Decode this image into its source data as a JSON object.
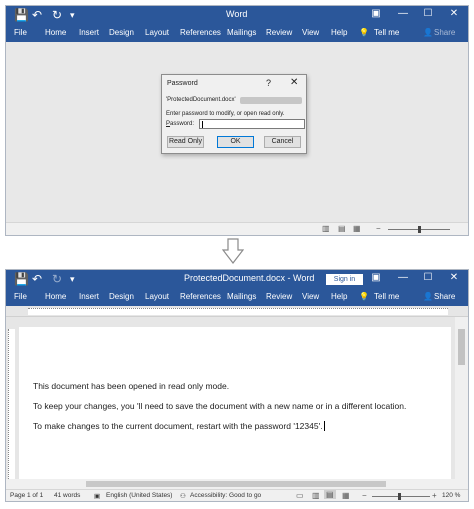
{
  "top": {
    "title": "Word",
    "tabs": [
      "File",
      "Home",
      "Insert",
      "Design",
      "Layout",
      "References",
      "Mailings",
      "Review",
      "View",
      "Help",
      "Tell me"
    ],
    "share": "Share",
    "dialog": {
      "title": "Password",
      "help": "?",
      "close": "✕",
      "filename": "'ProtectedDocument.docx'",
      "message": "Enter password to modify, or open read only.",
      "label": "Password:",
      "buttons": {
        "readonly": "Read Only",
        "ok": "OK",
        "cancel": "Cancel"
      }
    }
  },
  "bottom": {
    "title": "ProtectedDocument.docx  -  Word",
    "signin": "Sign in",
    "tabs": [
      "File",
      "Home",
      "Insert",
      "Design",
      "Layout",
      "References",
      "Mailings",
      "Review",
      "View",
      "Help",
      "Tell me"
    ],
    "share": "Share",
    "doc": {
      "lines": [
        "This document has been opened in read only mode.",
        "To keep your changes, you 'll need to save the document with a new name or in a different location.",
        "To make changes to the current document, restart with the password '12345'."
      ]
    },
    "status": {
      "page": "Page 1 of 1",
      "words": "41 words",
      "language": "English (United States)",
      "accessibility": "Accessibility: Good to go",
      "zoom": "120 %"
    }
  },
  "icons": {
    "save": "💾",
    "undo": "↶",
    "redo": "↻",
    "customize": "▾",
    "tellme": "💡",
    "share": "👤",
    "ribbon_options": "▣",
    "minimize": "—",
    "maximize": "☐",
    "close": "✕"
  },
  "colors": {
    "accent": "#2b579a",
    "dialog_ok_border": "#0078d7"
  }
}
